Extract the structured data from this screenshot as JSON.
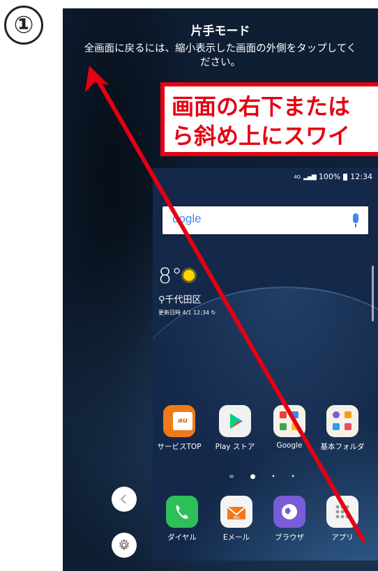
{
  "step": {
    "number": "①"
  },
  "one_hand_mode": {
    "title": "片手モード",
    "description_line1": "全画面に戻るには、縮小表示した画面の外側をタップしてく",
    "description_line2": "ださい。"
  },
  "callout": {
    "line1": "画面の右下または",
    "line2": "ら斜め上にスワイ",
    "color": "#e60012"
  },
  "mini_screen": {
    "status": {
      "signal": "4G",
      "battery": "100%",
      "time": "12:34"
    },
    "search": {
      "logo": "oogle",
      "icon": "mic-icon"
    },
    "weather": {
      "temperature": "8°",
      "icon": "sun-icon",
      "location": "千代田区",
      "updated": "更新日時 4/1 12:34"
    },
    "apps_row1": [
      {
        "label": "サービスTOP",
        "icon": "au-icon"
      },
      {
        "label": "Play ストア",
        "icon": "play-store-icon"
      },
      {
        "label": "Google",
        "icon": "google-folder-icon"
      },
      {
        "label": "基本フォルダ",
        "icon": "folder-icon"
      }
    ],
    "page_indicator": "= ● • •",
    "apps_dock": [
      {
        "label": "ダイヤル",
        "icon": "phone-icon"
      },
      {
        "label": "Eメール",
        "icon": "email-icon"
      },
      {
        "label": "ブラウザ",
        "icon": "browser-icon"
      },
      {
        "label": "アプリ",
        "icon": "apps-grid-icon"
      }
    ]
  },
  "side_controls": [
    {
      "icon": "chevron-left-icon"
    },
    {
      "icon": "settings-icon"
    }
  ],
  "annotation_arrow": {
    "color": "#e60012"
  }
}
